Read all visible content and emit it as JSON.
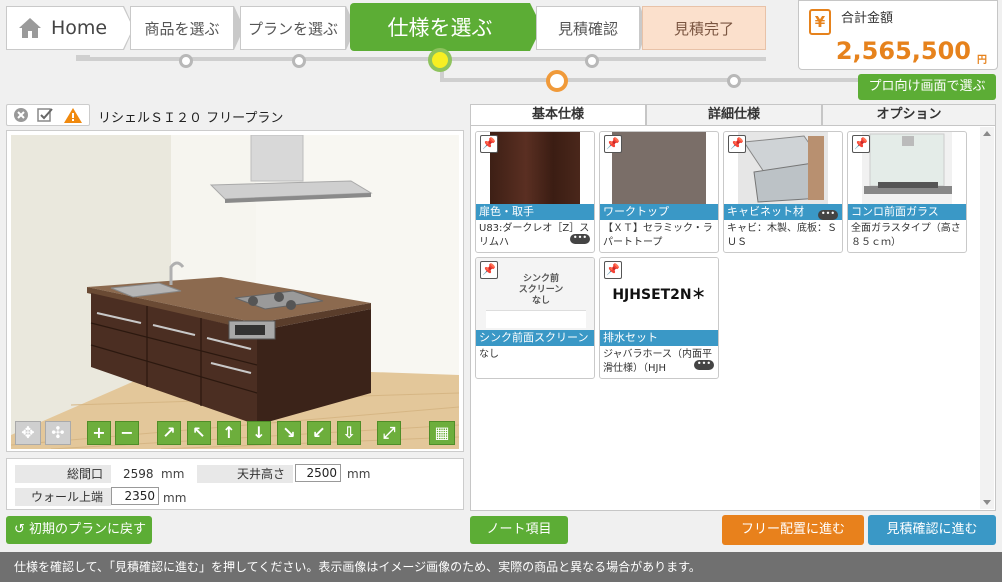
{
  "breadcrumb": {
    "home": "Home",
    "steps": [
      "商品を選ぶ",
      "プランを選ぶ",
      "仕様を選ぶ",
      "見積確認",
      "見積完了"
    ]
  },
  "total": {
    "label": "合計金額",
    "amount": "2,565,500",
    "unit": "円"
  },
  "pro_button": "プロ向け画面で選ぶ",
  "plan_name": "リシェルＳＩ２０ フリープラン",
  "dimensions": {
    "frontage_label": "総間口",
    "frontage_value": "2598",
    "frontage_unit": "mm",
    "ceiling_label": "天井高さ",
    "ceiling_value": "2500",
    "ceiling_unit": "mm",
    "wall_label": "ウォール上端",
    "wall_value": "2350",
    "wall_unit": "mm"
  },
  "reset_button": "初期のプランに戻す",
  "tabs": [
    "基本仕様",
    "詳細仕様",
    "オプション"
  ],
  "cards": [
    {
      "category": "扉色・取手",
      "desc": "U83:ダークレオ［Z］スリムハ",
      "more": true
    },
    {
      "category": "ワークトップ",
      "desc": "【ＸＴ】セラミック・ラパートトープ",
      "more": false
    },
    {
      "category": "キャビネット材",
      "desc": "キャビ：木製、底板：ＳＵＳ",
      "more": true
    },
    {
      "category": "コンロ前面ガラス",
      "desc": "全面ガラスタイプ（高さ８５ｃｍ）",
      "more": false
    },
    {
      "category": "シンク前面スクリーン",
      "desc": "なし",
      "more": false,
      "image_text": "シンク前\nスクリーン\nなし"
    },
    {
      "category": "排水セット",
      "desc": "ジャバラホース（内面平滑仕様）（HJH",
      "more": true,
      "image_text": "HJHSET2N＊"
    }
  ],
  "note_button": "ノート項目",
  "free_button": "フリー配置に進む",
  "estimate_button": "見積確認に進む",
  "status_message": "仕様を確認して、「見積確認に進む」を押してください。表示画像はイメージ画像のため、実際の商品と異なる場合があります。",
  "colors": {
    "green": "#5cad35",
    "orange": "#e8811c",
    "blue": "#3a98c6"
  }
}
